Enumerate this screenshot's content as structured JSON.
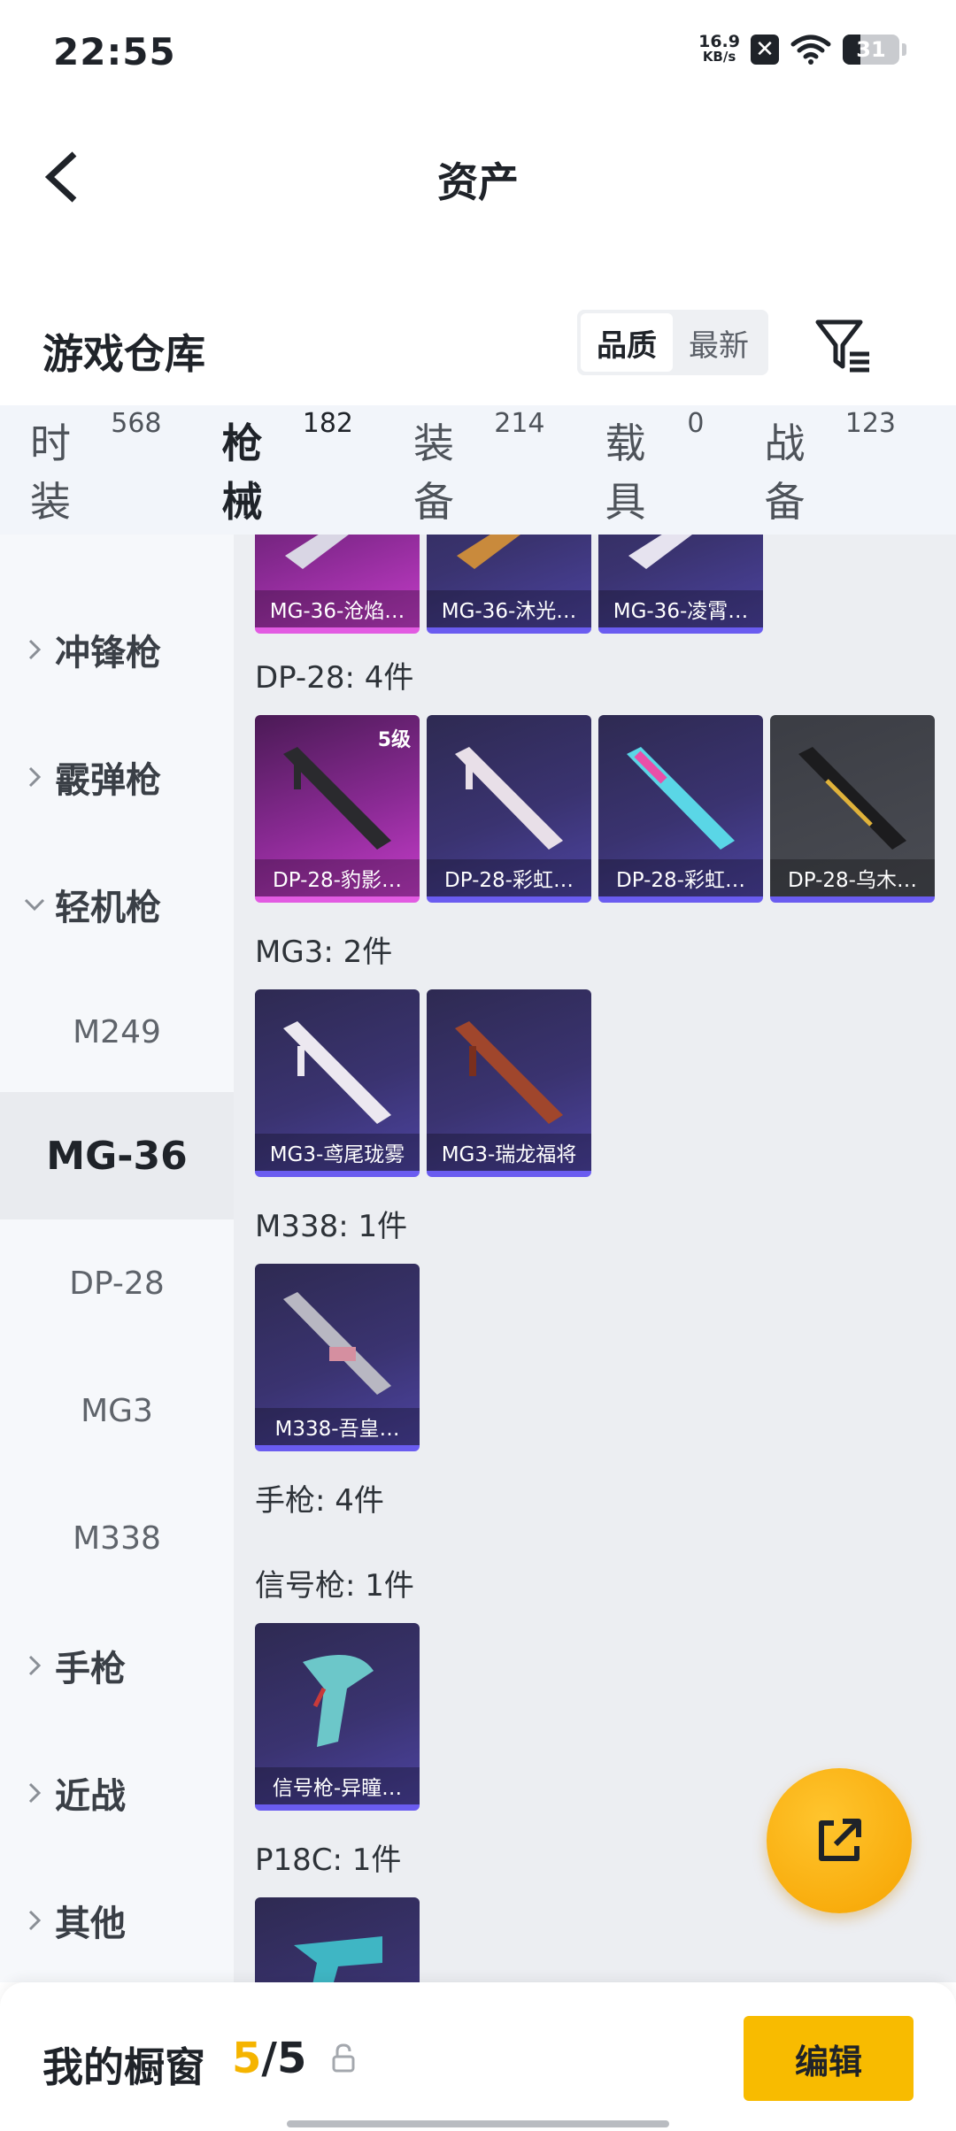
{
  "status_bar": {
    "time": "22:55",
    "net_speed_value": "16.9",
    "net_speed_unit": "KB/s",
    "battery_level": "31",
    "icons": [
      "x-notification-icon",
      "wifi-icon",
      "battery-icon"
    ]
  },
  "nav": {
    "title": "资产",
    "back_icon": "back-arrow-icon"
  },
  "section": {
    "title": "游戏仓库",
    "sort_options": [
      "品质",
      "最新"
    ],
    "sort_selected": "品质",
    "filter_icon": "filter-icon"
  },
  "category_tabs": [
    {
      "label": "时装",
      "count": "568"
    },
    {
      "label": "枪械",
      "count": "182",
      "active": true
    },
    {
      "label": "装备",
      "count": "214"
    },
    {
      "label": "载具",
      "count": "0"
    },
    {
      "label": "战备",
      "count": "123"
    }
  ],
  "sidebar": {
    "items": [
      {
        "label": "冲锋枪",
        "type": "group",
        "expanded": false
      },
      {
        "label": "霰弹枪",
        "type": "group",
        "expanded": false
      },
      {
        "label": "轻机枪",
        "type": "group",
        "expanded": true
      },
      {
        "label": "M249",
        "type": "sub"
      },
      {
        "label": "MG-36",
        "type": "sub",
        "selected": true
      },
      {
        "label": "DP-28",
        "type": "sub"
      },
      {
        "label": "MG3",
        "type": "sub"
      },
      {
        "label": "M338",
        "type": "sub"
      },
      {
        "label": "手枪",
        "type": "group",
        "expanded": false
      },
      {
        "label": "近战",
        "type": "group",
        "expanded": false
      },
      {
        "label": "其他",
        "type": "group",
        "expanded": false
      }
    ]
  },
  "main": {
    "top_row": [
      {
        "name": "MG-36-沧焰…",
        "rarity": "pink"
      },
      {
        "name": "MG-36-沐光…",
        "rarity": "purple"
      },
      {
        "name": "MG-36-凌霄…",
        "rarity": "purple"
      }
    ],
    "groups": [
      {
        "title": "DP-28: 4件",
        "items": [
          {
            "name": "DP-28-豹影…",
            "rarity": "pink",
            "level": "5级"
          },
          {
            "name": "DP-28-彩虹…",
            "rarity": "purple"
          },
          {
            "name": "DP-28-彩虹…",
            "rarity": "purple"
          },
          {
            "name": "DP-28-乌木…",
            "rarity": "gray"
          }
        ]
      },
      {
        "title": "MG3: 2件",
        "items": [
          {
            "name": "MG3-鸢尾珑雾",
            "rarity": "purple"
          },
          {
            "name": "MG3-瑞龙福将",
            "rarity": "purple"
          }
        ]
      },
      {
        "title": "M338: 1件",
        "items": [
          {
            "name": "M338-吾皇…",
            "rarity": "purple"
          }
        ]
      },
      {
        "title": "手枪: 4件",
        "items": []
      },
      {
        "title": "信号枪: 1件",
        "items": [
          {
            "name": "信号枪-异瞳…",
            "rarity": "purple"
          }
        ]
      },
      {
        "title": "P18C: 1件",
        "items": [
          {
            "name": "",
            "rarity": "purple"
          }
        ]
      }
    ]
  },
  "fab": {
    "icon": "share-export-icon"
  },
  "bottom_bar": {
    "title": "我的橱窗",
    "used": "5",
    "separator": "/",
    "total": "5",
    "lock_icon": "lock-icon",
    "edit_label": "编辑"
  },
  "colors": {
    "accent": "#f5b400",
    "purple_rarity": "#6a5cf0",
    "pink_rarity": "#e25be2"
  }
}
